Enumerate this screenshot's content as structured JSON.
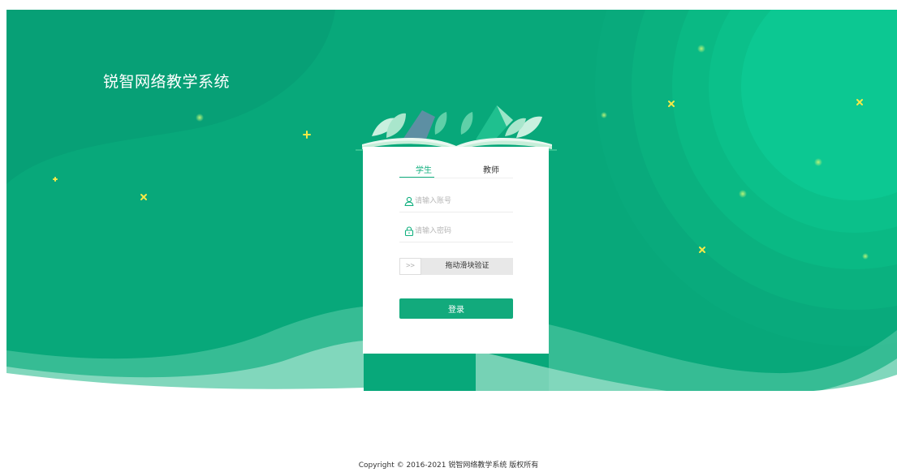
{
  "app": {
    "title": "锐智网络教学系统"
  },
  "login": {
    "tabs": [
      {
        "label": "学生",
        "active": true
      },
      {
        "label": "教师",
        "active": false
      }
    ],
    "account": {
      "placeholder": "请输入账号",
      "value": "",
      "icon": "user-icon"
    },
    "password": {
      "placeholder": "请输入密码",
      "value": "",
      "icon": "lock-icon"
    },
    "slider": {
      "handle_symbol": ">>",
      "label": "拖动滑块验证",
      "progress": 0
    },
    "submit_label": "登录"
  },
  "footer": {
    "copyright": "Copyright © 2016-2021 锐智网络教学系统 版权所有"
  },
  "colors": {
    "background": "#08a87a",
    "accent": "#12b07f",
    "button": "#12aa7c",
    "sparkle": "#f5e948"
  }
}
